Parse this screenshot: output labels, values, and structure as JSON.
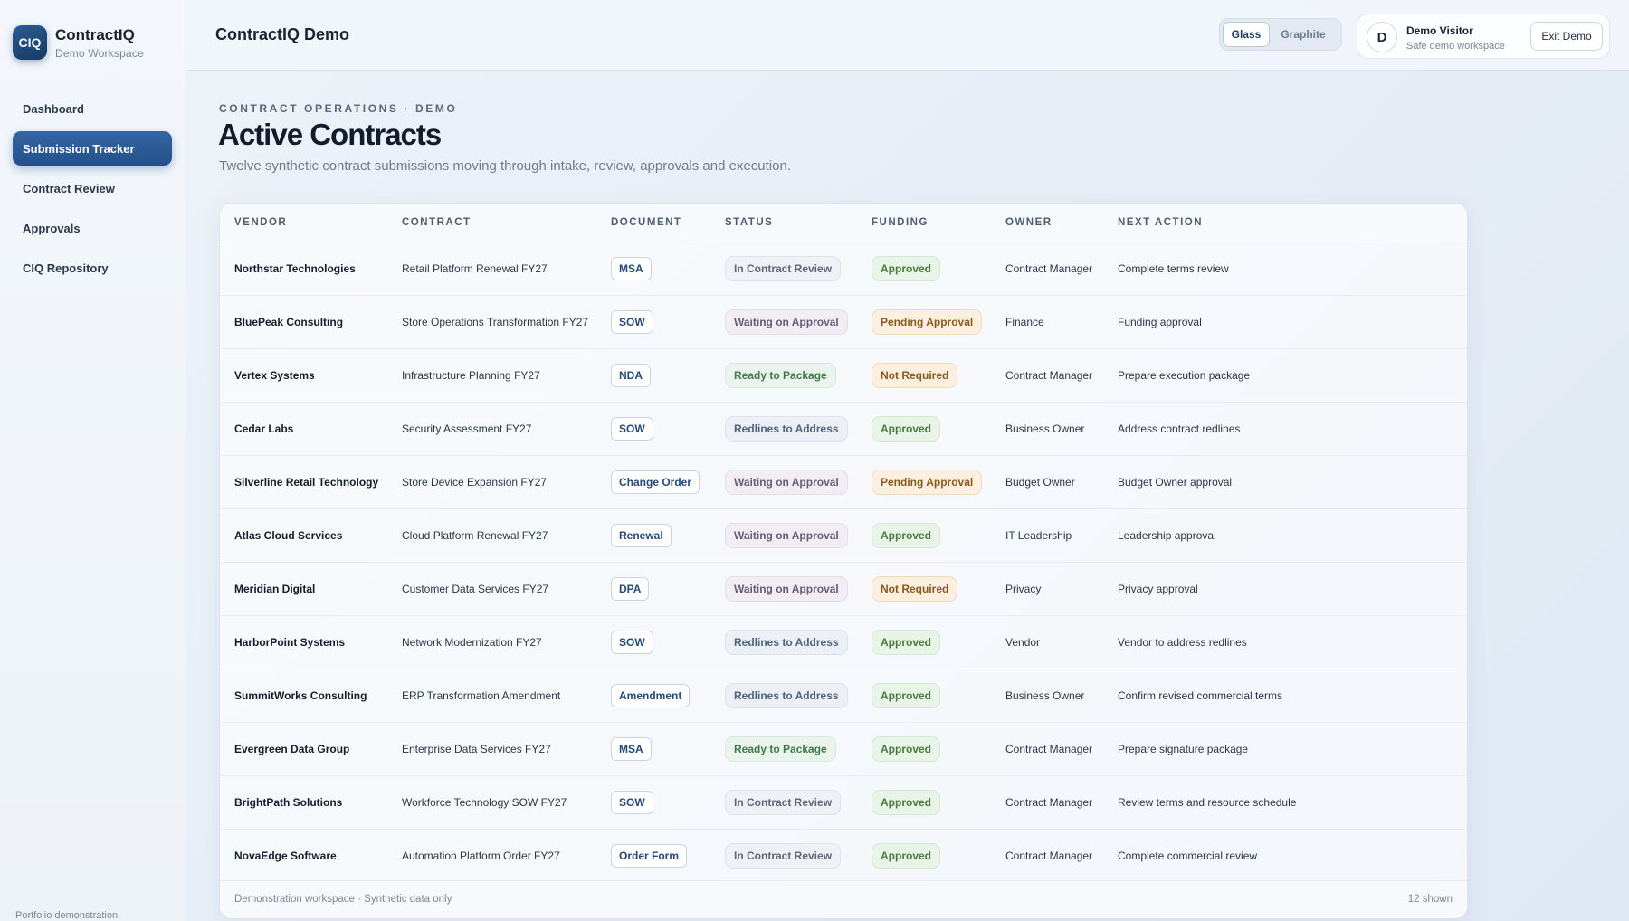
{
  "brand": {
    "logo": "CIQ",
    "name": "ContractIQ",
    "subtitle": "Demo Workspace"
  },
  "sidebar": {
    "items": [
      {
        "label": "Dashboard",
        "active": false
      },
      {
        "label": "Submission Tracker",
        "active": true
      },
      {
        "label": "Contract Review",
        "active": false
      },
      {
        "label": "Approvals",
        "active": false
      },
      {
        "label": "CIQ Repository",
        "active": false
      }
    ],
    "footer": "Portfolio demonstration."
  },
  "topbar": {
    "title": "ContractIQ Demo",
    "theme_options": [
      "Glass",
      "Graphite"
    ],
    "theme_selected": "Glass",
    "user": {
      "initial": "D",
      "name": "Demo Visitor",
      "subtitle": "Safe demo workspace"
    },
    "exit_label": "Exit Demo"
  },
  "page": {
    "eyebrow": "CONTRACT OPERATIONS · DEMO",
    "title": "Active Contracts",
    "subtitle": "Twelve synthetic contract submissions moving through intake, review, approvals and execution."
  },
  "table": {
    "columns": [
      "VENDOR",
      "CONTRACT",
      "DOCUMENT",
      "STATUS",
      "FUNDING",
      "OWNER",
      "NEXT ACTION"
    ],
    "rows": [
      {
        "vendor": "Northstar Technologies",
        "contract": "Retail Platform Renewal FY27",
        "document": "MSA",
        "status": "In Contract Review",
        "funding": "Approved",
        "owner": "Contract Manager",
        "next_action": "Complete terms review"
      },
      {
        "vendor": "BluePeak Consulting",
        "contract": "Store Operations Transformation FY27",
        "document": "SOW",
        "status": "Waiting on Approval",
        "funding": "Pending Approval",
        "owner": "Finance",
        "next_action": "Funding approval"
      },
      {
        "vendor": "Vertex Systems",
        "contract": "Infrastructure Planning FY27",
        "document": "NDA",
        "status": "Ready to Package",
        "funding": "Not Required",
        "owner": "Contract Manager",
        "next_action": "Prepare execution package"
      },
      {
        "vendor": "Cedar Labs",
        "contract": "Security Assessment FY27",
        "document": "SOW",
        "status": "Redlines to Address",
        "funding": "Approved",
        "owner": "Business Owner",
        "next_action": "Address contract redlines"
      },
      {
        "vendor": "Silverline Retail Technology",
        "contract": "Store Device Expansion FY27",
        "document": "Change Order",
        "status": "Waiting on Approval",
        "funding": "Pending Approval",
        "owner": "Budget Owner",
        "next_action": "Budget Owner approval"
      },
      {
        "vendor": "Atlas Cloud Services",
        "contract": "Cloud Platform Renewal FY27",
        "document": "Renewal",
        "status": "Waiting on Approval",
        "funding": "Approved",
        "owner": "IT Leadership",
        "next_action": "Leadership approval"
      },
      {
        "vendor": "Meridian Digital",
        "contract": "Customer Data Services FY27",
        "document": "DPA",
        "status": "Waiting on Approval",
        "funding": "Not Required",
        "owner": "Privacy",
        "next_action": "Privacy approval"
      },
      {
        "vendor": "HarborPoint Systems",
        "contract": "Network Modernization FY27",
        "document": "SOW",
        "status": "Redlines to Address",
        "funding": "Approved",
        "owner": "Vendor",
        "next_action": "Vendor to address redlines"
      },
      {
        "vendor": "SummitWorks Consulting",
        "contract": "ERP Transformation Amendment",
        "document": "Amendment",
        "status": "Redlines to Address",
        "funding": "Approved",
        "owner": "Business Owner",
        "next_action": "Confirm revised commercial terms"
      },
      {
        "vendor": "Evergreen Data Group",
        "contract": "Enterprise Data Services FY27",
        "document": "MSA",
        "status": "Ready to Package",
        "funding": "Approved",
        "owner": "Contract Manager",
        "next_action": "Prepare signature package"
      },
      {
        "vendor": "BrightPath Solutions",
        "contract": "Workforce Technology SOW FY27",
        "document": "SOW",
        "status": "In Contract Review",
        "funding": "Approved",
        "owner": "Contract Manager",
        "next_action": "Review terms and resource schedule"
      },
      {
        "vendor": "NovaEdge Software",
        "contract": "Automation Platform Order FY27",
        "document": "Order Form",
        "status": "In Contract Review",
        "funding": "Approved",
        "owner": "Contract Manager",
        "next_action": "Complete commercial review"
      }
    ],
    "footer_left": "Demonstration workspace · Synthetic data only",
    "footer_right": "12 shown"
  },
  "colors": {
    "accent": "#23508a",
    "approved": "#4b7a3f",
    "pending": "#8a5a1c"
  }
}
